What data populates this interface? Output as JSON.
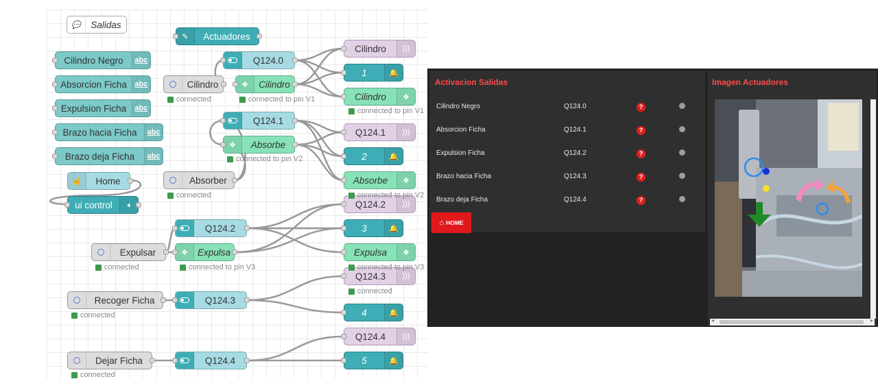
{
  "flow": {
    "comment": "Salidas",
    "link_node": "Actuadores",
    "text_nodes": [
      "Cilindro Negro",
      "Absorcion Ficha",
      "Expulsion Ficha",
      "Brazo hacia Ficha",
      "Brazo deja Ficha"
    ],
    "home_node": "Home",
    "ui_control": "ui control",
    "inject": [
      "Cilindro",
      "Absorber",
      "Expulsar",
      "Recoger Ficha",
      "Dejar Ficha"
    ],
    "switches": [
      "Q124.0",
      "Q124.1",
      "Q124.2",
      "Q124.3",
      "Q124.4"
    ],
    "blynk_write": [
      "Cilindro",
      "Absorbe",
      "Expulsa"
    ],
    "audio": [
      "Cilindro",
      "Q124.1",
      "Q124.2",
      "Q124.3",
      "Q124.4"
    ],
    "notify": [
      "1",
      "2",
      "3",
      "4",
      "5"
    ],
    "blynk_out": [
      "Cilindro",
      "Absorbe",
      "Expulsa"
    ],
    "status": {
      "connected": "connected",
      "pin_v1": "connected to pin V1",
      "pin_v2": "connected to pin V2",
      "pin_v3": "connected to pin V3"
    },
    "abc_glyph": "abc"
  },
  "dashboard": {
    "left_title": "Activacion Salidas",
    "rows": [
      {
        "name": "Cilindro Negro",
        "addr": "Q124.0"
      },
      {
        "name": "Absorcion Ficha",
        "addr": "Q124.1"
      },
      {
        "name": "Expulsion Ficha",
        "addr": "Q124.2"
      },
      {
        "name": "Brazo hacia Ficha",
        "addr": "Q124.3"
      },
      {
        "name": "Brazo deja Ficha",
        "addr": "Q124.4"
      }
    ],
    "question_glyph": "?",
    "home_button": "HOME",
    "right_title": "Imagen Actuadores"
  },
  "colors": {
    "dash_title": "#ff4a4a",
    "home_btn": "#e0191e",
    "status_dot": "#3e9a4f"
  }
}
